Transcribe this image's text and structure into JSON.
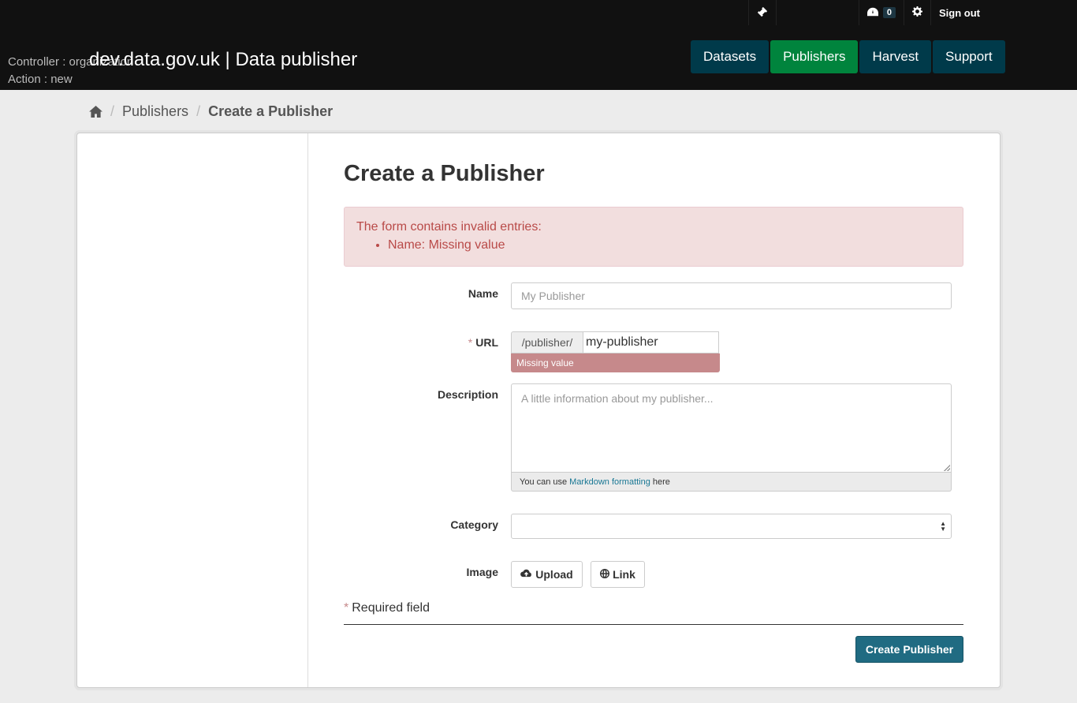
{
  "header": {
    "site_title": "dev.data.gov.uk | Data publisher",
    "debug_controller": "Controller : organization",
    "debug_action": "Action : new",
    "account": {
      "sysadmin_icon": "gavel-icon",
      "dashboard_icon": "dashboard-icon",
      "dashboard_count": "0",
      "settings_icon": "gear-icon",
      "sign_out": "Sign out"
    },
    "nav": [
      {
        "label": "Datasets",
        "active": false
      },
      {
        "label": "Publishers",
        "active": true
      },
      {
        "label": "Harvest",
        "active": false
      },
      {
        "label": "Support",
        "active": false
      }
    ]
  },
  "breadcrumb": {
    "home_icon": "home-icon",
    "items": [
      "Publishers",
      "Create a Publisher"
    ]
  },
  "form": {
    "heading": "Create a Publisher",
    "error_title": "The form contains invalid entries:",
    "errors": [
      "Name: Missing value"
    ],
    "name_label": "Name",
    "name_placeholder": "My Publisher",
    "url_required_mark": "*",
    "url_label": "URL",
    "url_prefix": "/publisher/",
    "url_value": "my-publisher",
    "url_error": "Missing value",
    "description_label": "Description",
    "description_placeholder": "A little information about my publisher...",
    "markdown_prefix": "You can use",
    "markdown_link": "Markdown formatting",
    "markdown_suffix": "here",
    "category_label": "Category",
    "category_value": "",
    "image_label": "Image",
    "upload_label": "Upload",
    "upload_icon": "cloud-upload-icon",
    "link_label": "Link",
    "link_icon": "globe-icon",
    "required_mark": "*",
    "required_note": "Required field",
    "submit_label": "Create Publisher"
  },
  "colors": {
    "masthead": "#111111",
    "nav": "#003a4a",
    "nav_active": "#00843d",
    "error_bg": "#f2dede",
    "error_text": "#b94a48",
    "submit": "#206b82"
  }
}
